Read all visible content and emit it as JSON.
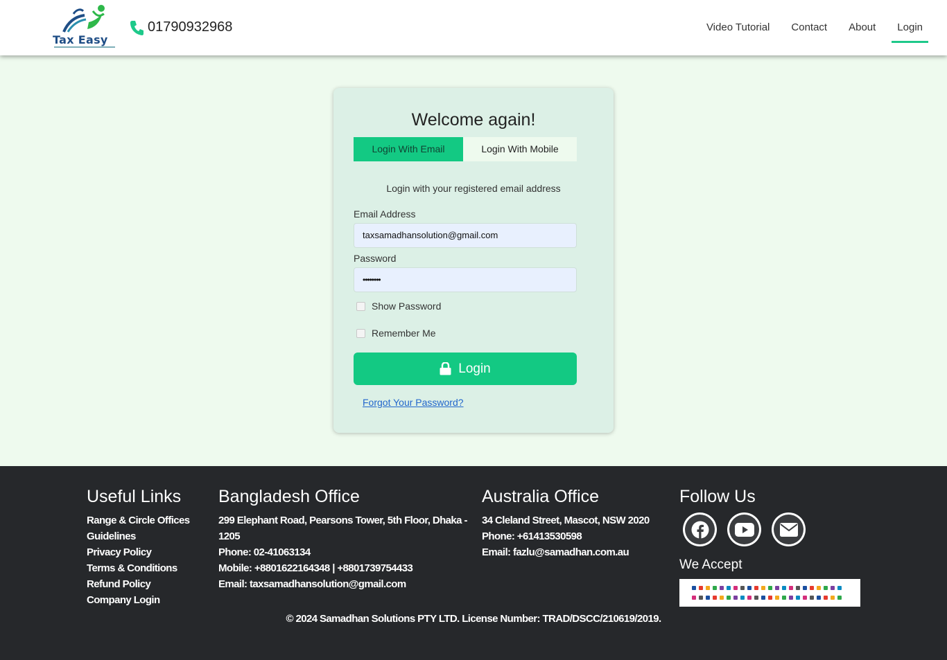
{
  "header": {
    "logo_text": "Tax Easy",
    "phone": "01790932968",
    "nav": [
      "Video Tutorial",
      "Contact",
      "About",
      "Login"
    ],
    "active_nav": "Login"
  },
  "login_card": {
    "title": "Welcome again!",
    "tab_email": "Login With Email",
    "tab_mobile": "Login With Mobile",
    "subtitle": "Login with your registered email address",
    "email_label": "Email Address",
    "email_value": "taxsamadhansolution@gmail.com",
    "password_label": "Password",
    "password_value": "••••••••",
    "show_password": "Show Password",
    "remember_me": "Remember Me",
    "login_button": "Login",
    "forgot_link": "Forgot Your Password?"
  },
  "footer": {
    "useful_links": {
      "title": "Useful Links",
      "items": [
        "Range & Circle Offices",
        "Guidelines",
        "Privacy Policy",
        "Terms & Conditions",
        "Refund Policy",
        "Company Login"
      ]
    },
    "bangladesh": {
      "title": "Bangladesh Office",
      "lines": [
        "299 Elephant Road, Pearsons Tower, 5th Floor, Dhaka -",
        "1205",
        "Phone: 02-41063134",
        "Mobile: +8801622164348 | +8801739754433",
        "Email: taxsamadhansolution@gmail.com"
      ]
    },
    "australia": {
      "title": "Australia Office",
      "lines": [
        "34 Cleland Street, Mascot, NSW 2020",
        "Phone: +61413530598",
        "Email: fazlu@samadhan.com.au"
      ]
    },
    "follow": {
      "title": "Follow Us",
      "icons": [
        "facebook-icon",
        "youtube-icon",
        "envelope-icon"
      ]
    },
    "we_accept": "We Accept",
    "copyright": "© 2024 Samadhan Solutions PTY LTD. License Number: TRAD/DSCC/210619/2019."
  },
  "colors": {
    "accent": "#13c983",
    "page_bg": "#eefaee",
    "card_bg": "#dcf0e6",
    "footer_bg": "#26282b",
    "input_bg": "#e8f0fe"
  }
}
